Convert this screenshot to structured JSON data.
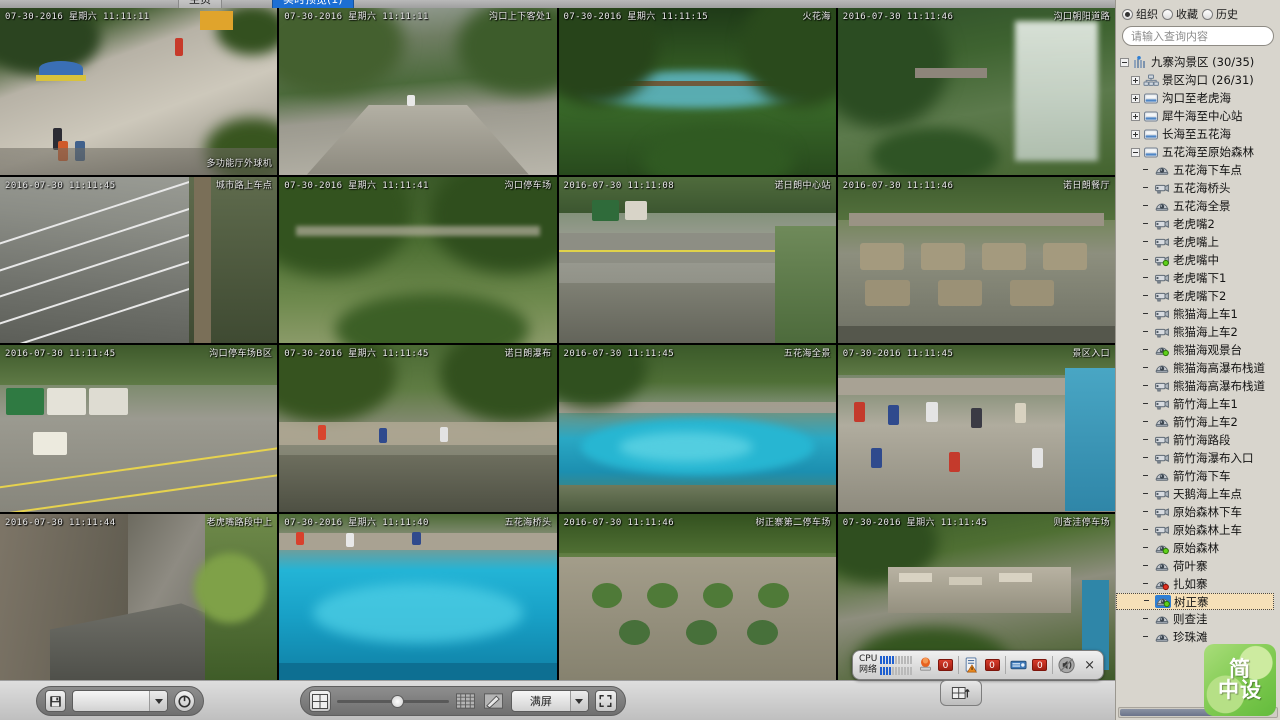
{
  "tabs": [
    {
      "label": "主页",
      "selected": false
    },
    {
      "label": "实时预览(1)",
      "selected": true
    }
  ],
  "sidebar": {
    "view_modes": [
      {
        "label": "组织",
        "selected": true,
        "name": "organization"
      },
      {
        "label": "收藏",
        "selected": false,
        "name": "favorites"
      },
      {
        "label": "历史",
        "selected": false,
        "name": "history"
      }
    ],
    "search": {
      "placeholder": "请输入查询内容",
      "value": "",
      "icon": "search-icon"
    },
    "tree": [
      {
        "label": "九寨沟景区 (30/35)",
        "depth": 0,
        "expander": "minus",
        "icon": "site-icon"
      },
      {
        "label": "景区沟口 (26/31)",
        "depth": 1,
        "expander": "plus",
        "icon": "group-icon"
      },
      {
        "label": "沟口至老虎海",
        "depth": 1,
        "expander": "plus",
        "icon": "server-icon"
      },
      {
        "label": "犀牛海至中心站",
        "depth": 1,
        "expander": "plus",
        "icon": "server-icon"
      },
      {
        "label": "长海至五花海",
        "depth": 1,
        "expander": "plus",
        "icon": "server-icon"
      },
      {
        "label": "五花海至原始森林",
        "depth": 1,
        "expander": "minus",
        "icon": "server-icon"
      },
      {
        "label": "五花海下车点",
        "depth": 2,
        "expander": "none",
        "icon": "dome-camera-icon"
      },
      {
        "label": "五花海桥头",
        "depth": 2,
        "expander": "none",
        "icon": "bullet-camera-icon"
      },
      {
        "label": "五花海全景",
        "depth": 2,
        "expander": "none",
        "icon": "dome-camera-icon"
      },
      {
        "label": "老虎嘴2",
        "depth": 2,
        "expander": "none",
        "icon": "bullet-camera-icon"
      },
      {
        "label": "老虎嘴上",
        "depth": 2,
        "expander": "none",
        "icon": "bullet-camera-icon"
      },
      {
        "label": "老虎嘴中",
        "depth": 2,
        "expander": "none",
        "icon": "bullet-camera-online-icon"
      },
      {
        "label": "老虎嘴下1",
        "depth": 2,
        "expander": "none",
        "icon": "bullet-camera-icon"
      },
      {
        "label": "老虎嘴下2",
        "depth": 2,
        "expander": "none",
        "icon": "bullet-camera-icon"
      },
      {
        "label": "熊猫海上车1",
        "depth": 2,
        "expander": "none",
        "icon": "bullet-camera-icon"
      },
      {
        "label": "熊猫海上车2",
        "depth": 2,
        "expander": "none",
        "icon": "bullet-camera-icon"
      },
      {
        "label": "熊猫海观景台",
        "depth": 2,
        "expander": "none",
        "icon": "dome-camera-online-icon"
      },
      {
        "label": "熊猫海高瀑布栈道",
        "depth": 2,
        "expander": "none",
        "icon": "dome-camera-icon"
      },
      {
        "label": "熊猫海高瀑布栈道",
        "depth": 2,
        "expander": "none",
        "icon": "bullet-camera-icon"
      },
      {
        "label": "箭竹海上车1",
        "depth": 2,
        "expander": "none",
        "icon": "bullet-camera-icon"
      },
      {
        "label": "箭竹海上车2",
        "depth": 2,
        "expander": "none",
        "icon": "dome-camera-icon"
      },
      {
        "label": "箭竹海路段",
        "depth": 2,
        "expander": "none",
        "icon": "bullet-camera-icon"
      },
      {
        "label": "箭竹海瀑布入口",
        "depth": 2,
        "expander": "none",
        "icon": "bullet-camera-icon"
      },
      {
        "label": "箭竹海下车",
        "depth": 2,
        "expander": "none",
        "icon": "dome-camera-icon"
      },
      {
        "label": "天鹅海上车点",
        "depth": 2,
        "expander": "none",
        "icon": "bullet-camera-icon"
      },
      {
        "label": "原始森林下车",
        "depth": 2,
        "expander": "none",
        "icon": "bullet-camera-icon"
      },
      {
        "label": "原始森林上车",
        "depth": 2,
        "expander": "none",
        "icon": "bullet-camera-icon"
      },
      {
        "label": "原始森林",
        "depth": 2,
        "expander": "none",
        "icon": "dome-camera-online-icon"
      },
      {
        "label": "荷叶寨",
        "depth": 2,
        "expander": "none",
        "icon": "dome-camera-icon"
      },
      {
        "label": "扎如寨",
        "depth": 2,
        "expander": "none",
        "icon": "dome-camera-offline-icon"
      },
      {
        "label": "树正寨",
        "depth": 2,
        "expander": "none",
        "icon": "dome-camera-selected-icon",
        "selected": true
      },
      {
        "label": "则查洼",
        "depth": 2,
        "expander": "none",
        "icon": "dome-camera-icon"
      },
      {
        "label": "珍珠滩",
        "depth": 2,
        "expander": "none",
        "icon": "dome-camera-icon"
      }
    ]
  },
  "wall": {
    "rows": 4,
    "cols": 4,
    "tiles": [
      {
        "time": "07-30-2016 星期六 11:11:11",
        "name": "多功能厅外球机",
        "name_pos": "bot",
        "selected": false
      },
      {
        "time": "07-30-2016 星期六 11:11:11",
        "name": "沟口上下客处1",
        "name_pos": "top",
        "selected": false
      },
      {
        "time": "07-30-2016 星期六 11:11:15",
        "name": "火花海",
        "name_pos": "top",
        "selected": false
      },
      {
        "time": "2016-07-30 11:11:46",
        "name": "沟口朝阳道路",
        "name_pos": "top",
        "selected": false
      },
      {
        "time": "2016-07-30 11:11:45",
        "name": "城市路上车点",
        "name_pos": "top",
        "selected": false
      },
      {
        "time": "07-30-2016 星期六 11:11:41",
        "name": "沟口停车场",
        "name_pos": "top",
        "selected": false
      },
      {
        "time": "2016-07-30 11:11:08",
        "name": "诺日朗中心站",
        "name_pos": "top",
        "selected": false
      },
      {
        "time": "2016-07-30 11:11:46",
        "name": "诺日朗餐厅",
        "name_pos": "top",
        "selected": false
      },
      {
        "time": "2016-07-30 11:11:45",
        "name": "沟口停车场B区",
        "name_pos": "top",
        "selected": false
      },
      {
        "time": "07-30-2016 星期六 11:11:45",
        "name": "诺日朗瀑布",
        "name_pos": "top",
        "selected": false
      },
      {
        "time": "2016-07-30 11:11:45",
        "name": "五花海全景",
        "name_pos": "top",
        "selected": false
      },
      {
        "time": "07-30-2016 11:11:45",
        "name": "景区入口",
        "name_pos": "top",
        "selected": false
      },
      {
        "time": "2016-07-30 11:11:44",
        "name": "老虎嘴路段中上",
        "name_pos": "top",
        "selected": false
      },
      {
        "time": "07-30-2016 星期六 11:11:40",
        "name": "五花海桥头",
        "name_pos": "top",
        "selected": false
      },
      {
        "time": "2016-07-30 11:11:46",
        "name": "树正寨第二停车场",
        "name_pos": "top",
        "selected": false
      },
      {
        "time": "07-30-2016 星期六 11:11:45",
        "name": "则查洼停车场",
        "name_pos": "top",
        "selected": false
      }
    ]
  },
  "toolbar": {
    "save_icon": "save-icon",
    "preset_value": "",
    "refresh_icon": "refresh-icon",
    "layout_icon": "layout-2x2-icon",
    "slider_value": 50,
    "grid_icon": "grid-icon",
    "edit_icon": "edit-icon",
    "screen_mode": "满屏",
    "fullscreen_icon": "fullscreen-icon"
  },
  "status": {
    "cpu_label": "CPU",
    "cpu_bars_on": 5,
    "cpu_bars_total": 11,
    "net_label": "网络",
    "net_bars_on": 4,
    "net_bars_total": 11,
    "alarm_icon": "alarm-light-icon",
    "alarm_count": "0",
    "event_icon": "event-log-icon",
    "event_count": "0",
    "device_icon": "device-icon",
    "device_count": "0",
    "audio_icon": "speaker-mute-icon",
    "close_label": "×",
    "pull_icon": "panel-toggle-icon"
  },
  "logo": {
    "line1": "简",
    "line2": "中设",
    "accent": "#7ec94f"
  }
}
